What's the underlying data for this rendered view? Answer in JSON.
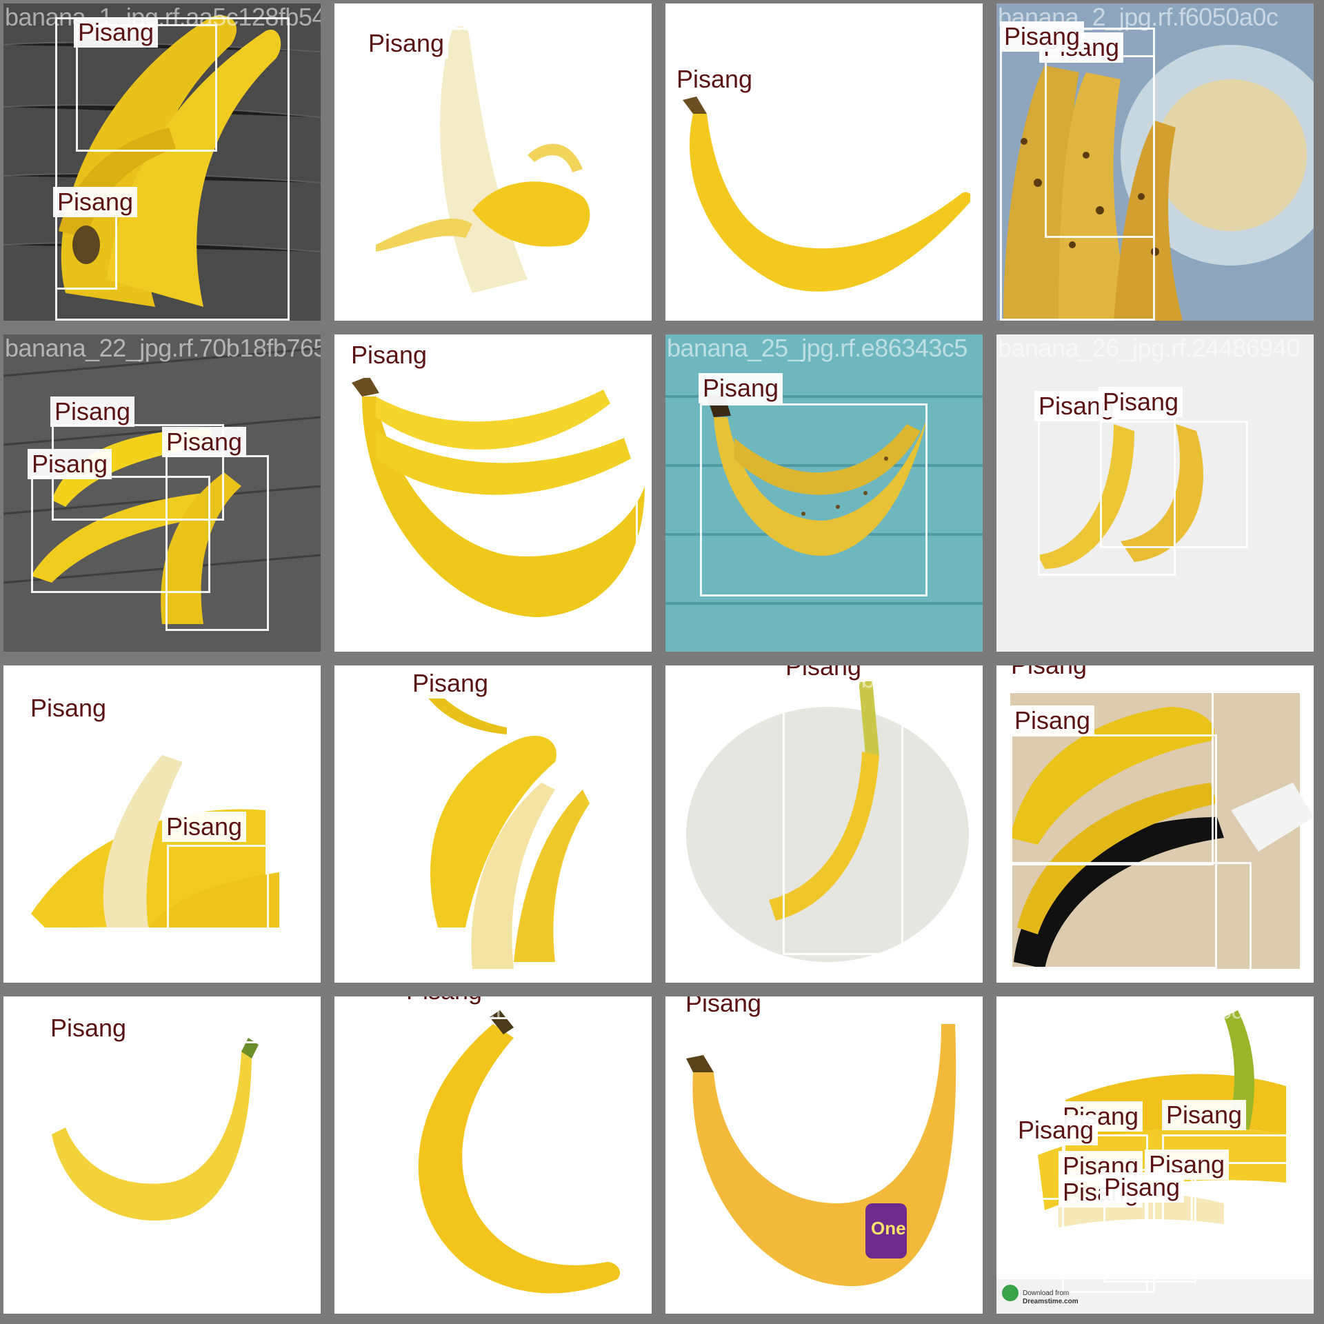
{
  "label_text": "Pisang",
  "colors": {
    "grid_background": "#7a7a7a",
    "box_outline": "#ffffff",
    "label_text": "#5a1212",
    "label_fill": "#ffffff",
    "banana_yellow": "#f3c91f"
  },
  "tiles": [
    {
      "filename": "banana_1_jpg.rf.aa5c128fb54b712eb389059131ca07e5",
      "detections": 3
    },
    {
      "filename": "banana_1_jpg.rf.a2b389059131ca07ea91771396a68f",
      "detections": 1
    },
    {
      "filename": "banana_18_jpg.rf.ef045967c9f1ef14a4bbe05050a0c",
      "detections": 1
    },
    {
      "filename": "banana_2_jpg.rf.f6050a0c",
      "detections": 2
    },
    {
      "filename": "banana_22_jpg.rf.70b18fb765",
      "detections": 3
    },
    {
      "filename": "banana_23_jpg.rf.99977647a",
      "detections": 1
    },
    {
      "filename": "banana_25_jpg.rf.e86343c5",
      "detections": 1
    },
    {
      "filename": "banana_26_jpg.rf.24486940",
      "detections": 2
    },
    {
      "filename": "banana_27_jpg.rf.547cab16",
      "detections": 2
    },
    {
      "filename": "banana_28_jpg.rf.fabee9f302",
      "detections": 1
    },
    {
      "filename": "banana_3_jpg.rf.5b9386cc",
      "detections": 1
    },
    {
      "filename": "banana_30_jpg.rf.8c552bbd",
      "detections": 3
    },
    {
      "filename": "banana_39_jpg.rf.d36b292",
      "detections": 1
    },
    {
      "filename": "banana_4_jpg.rf.eec30be",
      "detections": 1
    },
    {
      "filename": "banana_41_jpg.rf.12130b17",
      "detections": 1
    },
    {
      "filename": "banana_5_jpg.rf.200cd079",
      "detections": 7
    }
  ],
  "watermark": {
    "logo_text": "One",
    "download_line1": "Download from",
    "download_line2": "Dreamstime.com"
  }
}
